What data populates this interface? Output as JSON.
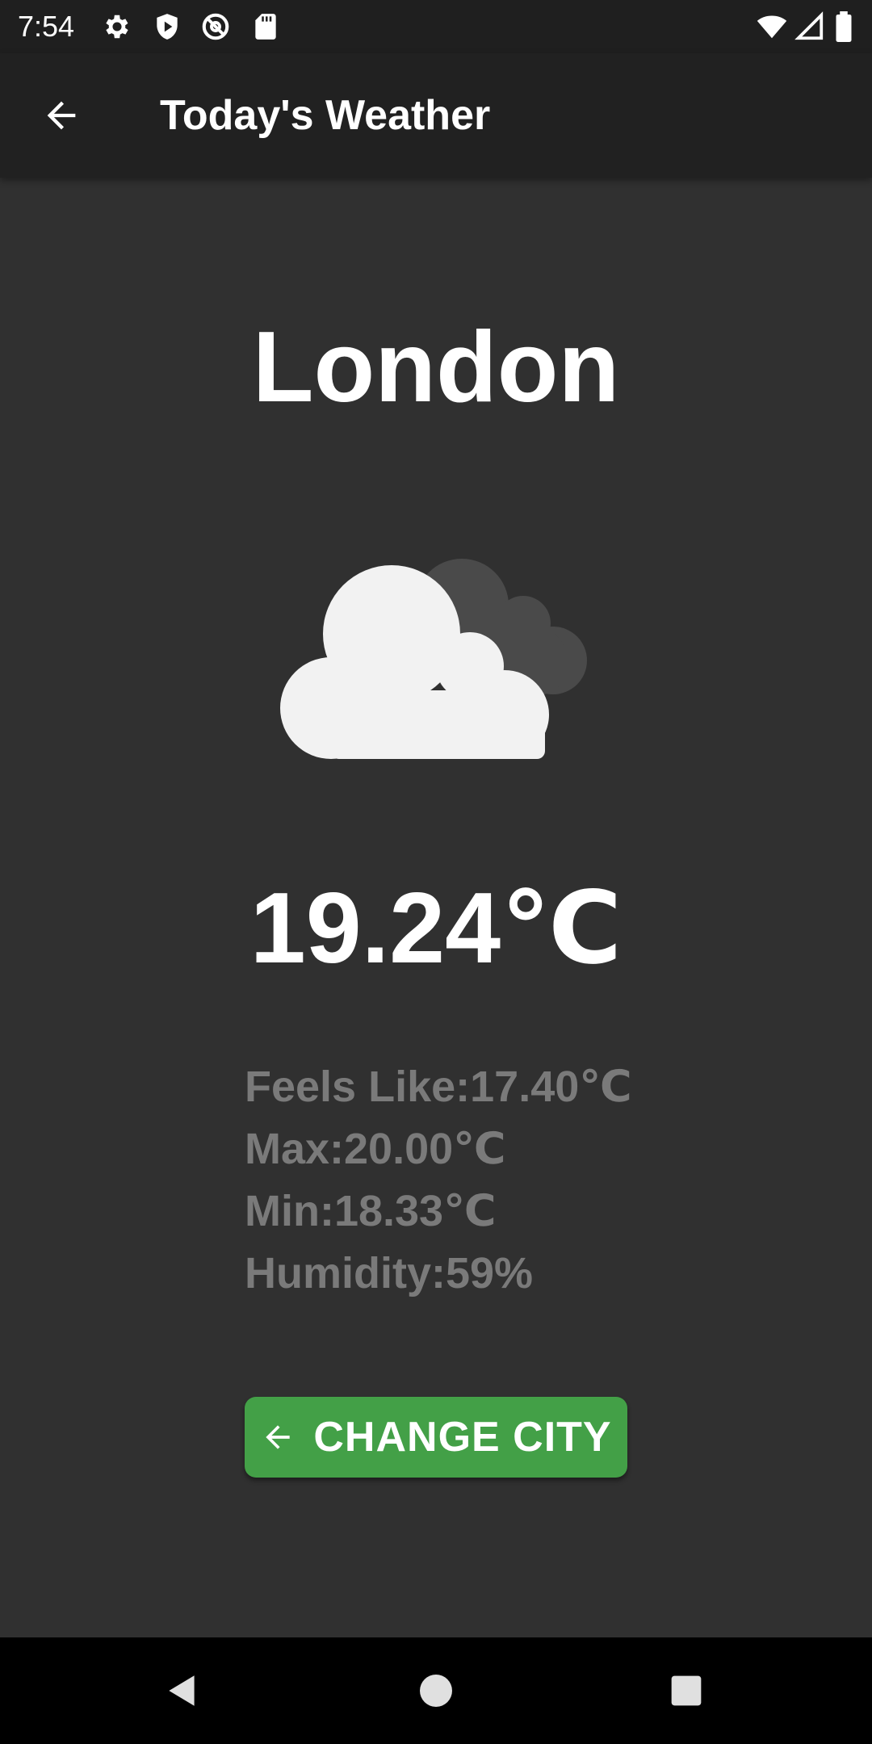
{
  "status_bar": {
    "time": "7:54",
    "left_icons": [
      "settings-icon",
      "shield-play-icon",
      "at-sync-icon",
      "sd-card-icon"
    ],
    "right_icons": [
      "wifi-icon",
      "signal-icon",
      "battery-icon"
    ]
  },
  "app_bar": {
    "back_icon": "arrow-back-icon",
    "title": "Today's Weather"
  },
  "weather": {
    "city": "London",
    "condition_icon": "broken-clouds-icon",
    "temperature": "19.24℃",
    "details": {
      "feels_like": "Feels Like:17.40℃",
      "max": "Max:20.00℃",
      "min": "Min:18.33℃",
      "humidity": "Humidity:59%"
    }
  },
  "button": {
    "icon": "arrow-back-icon",
    "label": "CHANGE CITY"
  },
  "nav_bar": {
    "back": "nav-back-icon",
    "home": "nav-home-icon",
    "recents": "nav-recents-icon"
  },
  "colors": {
    "background": "#303030",
    "app_bar": "#212121",
    "status_bar": "#1f1f1f",
    "text_primary": "#ffffff",
    "text_secondary": "#7a7a7a",
    "button": "#43a047",
    "cloud_front": "#f2f2f2",
    "cloud_back": "#4a4a4a"
  }
}
